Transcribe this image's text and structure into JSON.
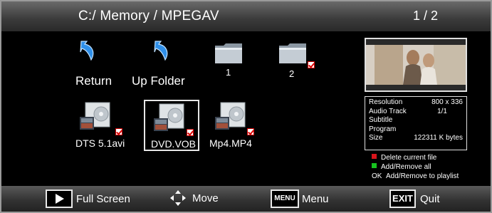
{
  "header": {
    "path": "C:/  Memory / MPEGAV",
    "page": "1 / 2"
  },
  "grid": {
    "row1": [
      {
        "label": "Return",
        "icon": "return-arrow-icon"
      },
      {
        "label": "Up Folder",
        "icon": "return-arrow-icon"
      },
      {
        "label": "1",
        "icon": "folder-icon",
        "checked": false
      },
      {
        "label": "2",
        "icon": "folder-icon",
        "checked": true
      }
    ],
    "row2": [
      {
        "label": "DTS 5.1avi",
        "icon": "video-file-icon",
        "checked": true,
        "selected": false
      },
      {
        "label": "DVD.VOB",
        "icon": "video-file-icon",
        "checked": true,
        "selected": true
      },
      {
        "label": "Mp4.MP4",
        "icon": "video-file-icon",
        "checked": true,
        "selected": false
      }
    ]
  },
  "info": {
    "resolution_label": "Resolution",
    "resolution_value": "800 x 336",
    "audio_label": "Audio Track",
    "audio_value": "1/1",
    "subtitle_label": "Subtitle",
    "program_label": "Program",
    "size_label": "Size",
    "size_value": "122311 K bytes"
  },
  "legend": {
    "delete": "Delete current file",
    "add_all": "Add/Remove all",
    "ok_key": "OK",
    "playlist": "Add/Remove to playlist",
    "red": "#d8141b",
    "green": "#17c21f"
  },
  "footer": {
    "fullscreen": "Full Screen",
    "move": "Move",
    "menu_key": "MENU",
    "menu": "Menu",
    "exit_key": "EXIT",
    "quit": "Quit"
  }
}
